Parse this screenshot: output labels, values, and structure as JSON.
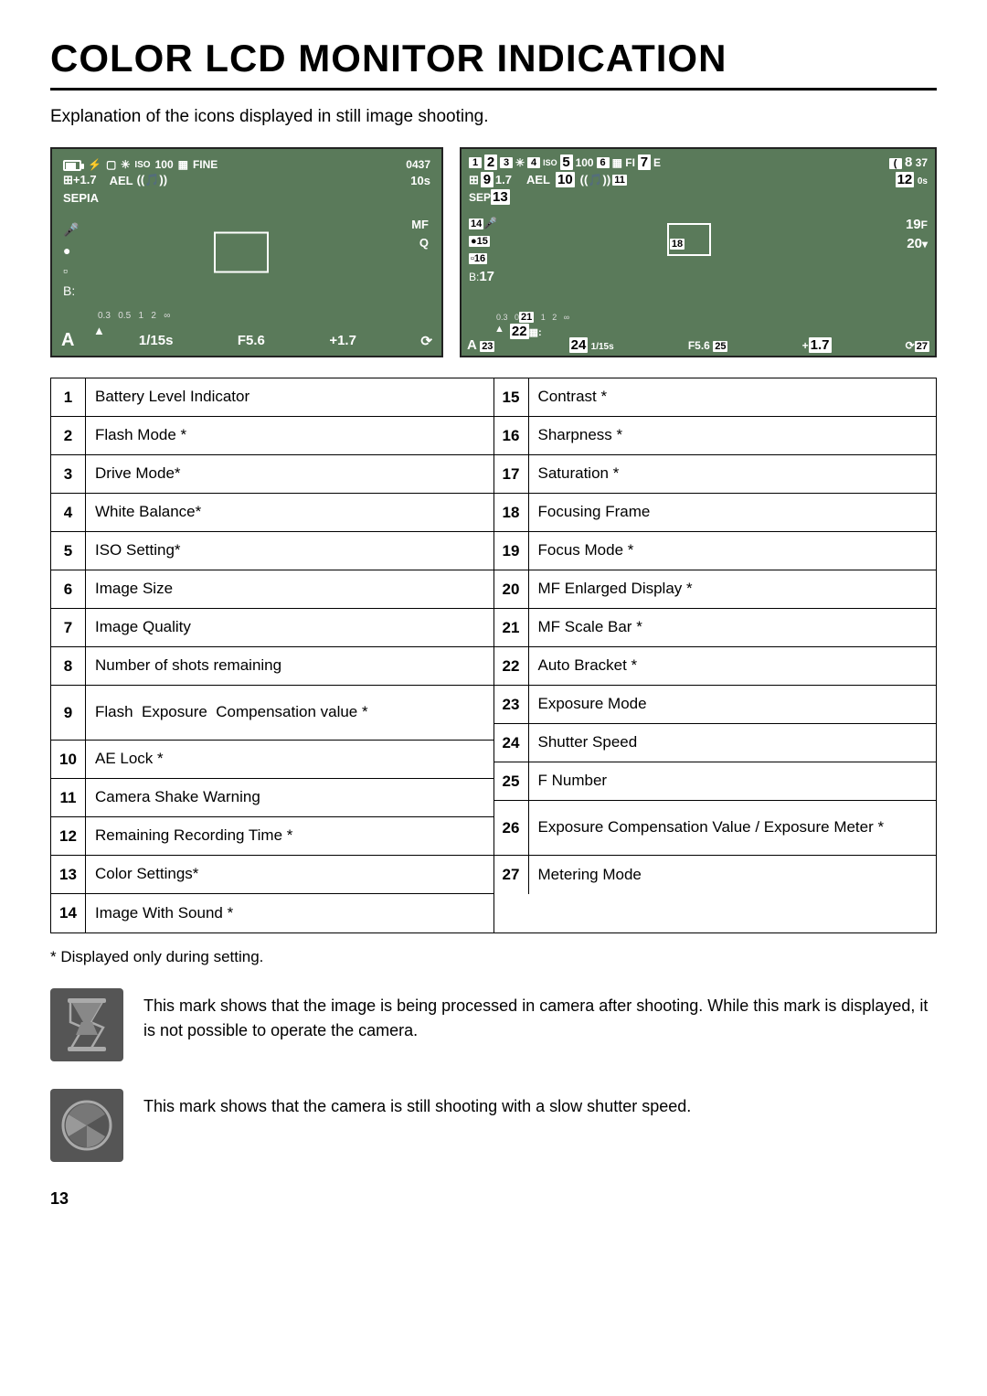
{
  "page": {
    "title": "COLOR LCD MONITOR INDICATION",
    "subtitle": "Explanation of the icons displayed in still image shooting.",
    "page_number": "13",
    "footnote": "* Displayed only during setting."
  },
  "lcd_left": {
    "top_icons": "▣ ⚡ ▢ ✳ ISO 100 ▦ FINE 0437",
    "ael": "AEL",
    "drive": "((🎵))",
    "timer": "10s",
    "ev": "⊞+1.7",
    "sepia": "SEPIA",
    "mic": "🎤",
    "circle": "●",
    "grid": "▫",
    "bracket": "B:",
    "mf": "MF",
    "q": "Q",
    "scale": "0.3   0.5   1   2  ∞",
    "bottom_triangle": "▲",
    "exposure_a": "A",
    "shutter": "1/15s",
    "fnum": "F5.6",
    "ev2": "+1.7",
    "rec_icon": "⟳"
  },
  "indicators": {
    "left": [
      {
        "num": "1",
        "desc": "Battery Level Indicator"
      },
      {
        "num": "2",
        "desc": "Flash Mode *"
      },
      {
        "num": "3",
        "desc": "Drive Mode*"
      },
      {
        "num": "4",
        "desc": "White Balance*"
      },
      {
        "num": "5",
        "desc": "ISO Setting*"
      },
      {
        "num": "6",
        "desc": "Image Size"
      },
      {
        "num": "7",
        "desc": "Image Quality"
      },
      {
        "num": "8",
        "desc": "Number of shots remaining"
      },
      {
        "num": "9",
        "desc": "Flash  Exposure  Compensation value *"
      },
      {
        "num": "10",
        "desc": "AE Lock *"
      },
      {
        "num": "11",
        "desc": "Camera Shake Warning"
      },
      {
        "num": "12",
        "desc": "Remaining Recording Time *"
      },
      {
        "num": "13",
        "desc": "Color Settings*"
      },
      {
        "num": "14",
        "desc": "Image With Sound *"
      }
    ],
    "right": [
      {
        "num": "15",
        "desc": "Contrast *"
      },
      {
        "num": "16",
        "desc": "Sharpness *"
      },
      {
        "num": "17",
        "desc": "Saturation *"
      },
      {
        "num": "18",
        "desc": "Focusing Frame"
      },
      {
        "num": "19",
        "desc": "Focus Mode *"
      },
      {
        "num": "20",
        "desc": "MF Enlarged Display *"
      },
      {
        "num": "21",
        "desc": "MF Scale Bar *"
      },
      {
        "num": "22",
        "desc": "Auto Bracket *"
      },
      {
        "num": "23",
        "desc": "Exposure Mode"
      },
      {
        "num": "24",
        "desc": "Shutter Speed"
      },
      {
        "num": "25",
        "desc": "F Number"
      },
      {
        "num": "26",
        "desc": "Exposure Compensation Value / Exposure Meter *"
      },
      {
        "num": "27",
        "desc": "Metering Mode"
      }
    ]
  },
  "notes": [
    {
      "id": "hourglass",
      "text": "This mark shows that the image is being processed in camera after shooting.  While this mark is displayed, it is not possible to operate the camera."
    },
    {
      "id": "shutter-slow",
      "text": "This mark shows that the camera is still shooting with a slow shutter speed."
    }
  ]
}
